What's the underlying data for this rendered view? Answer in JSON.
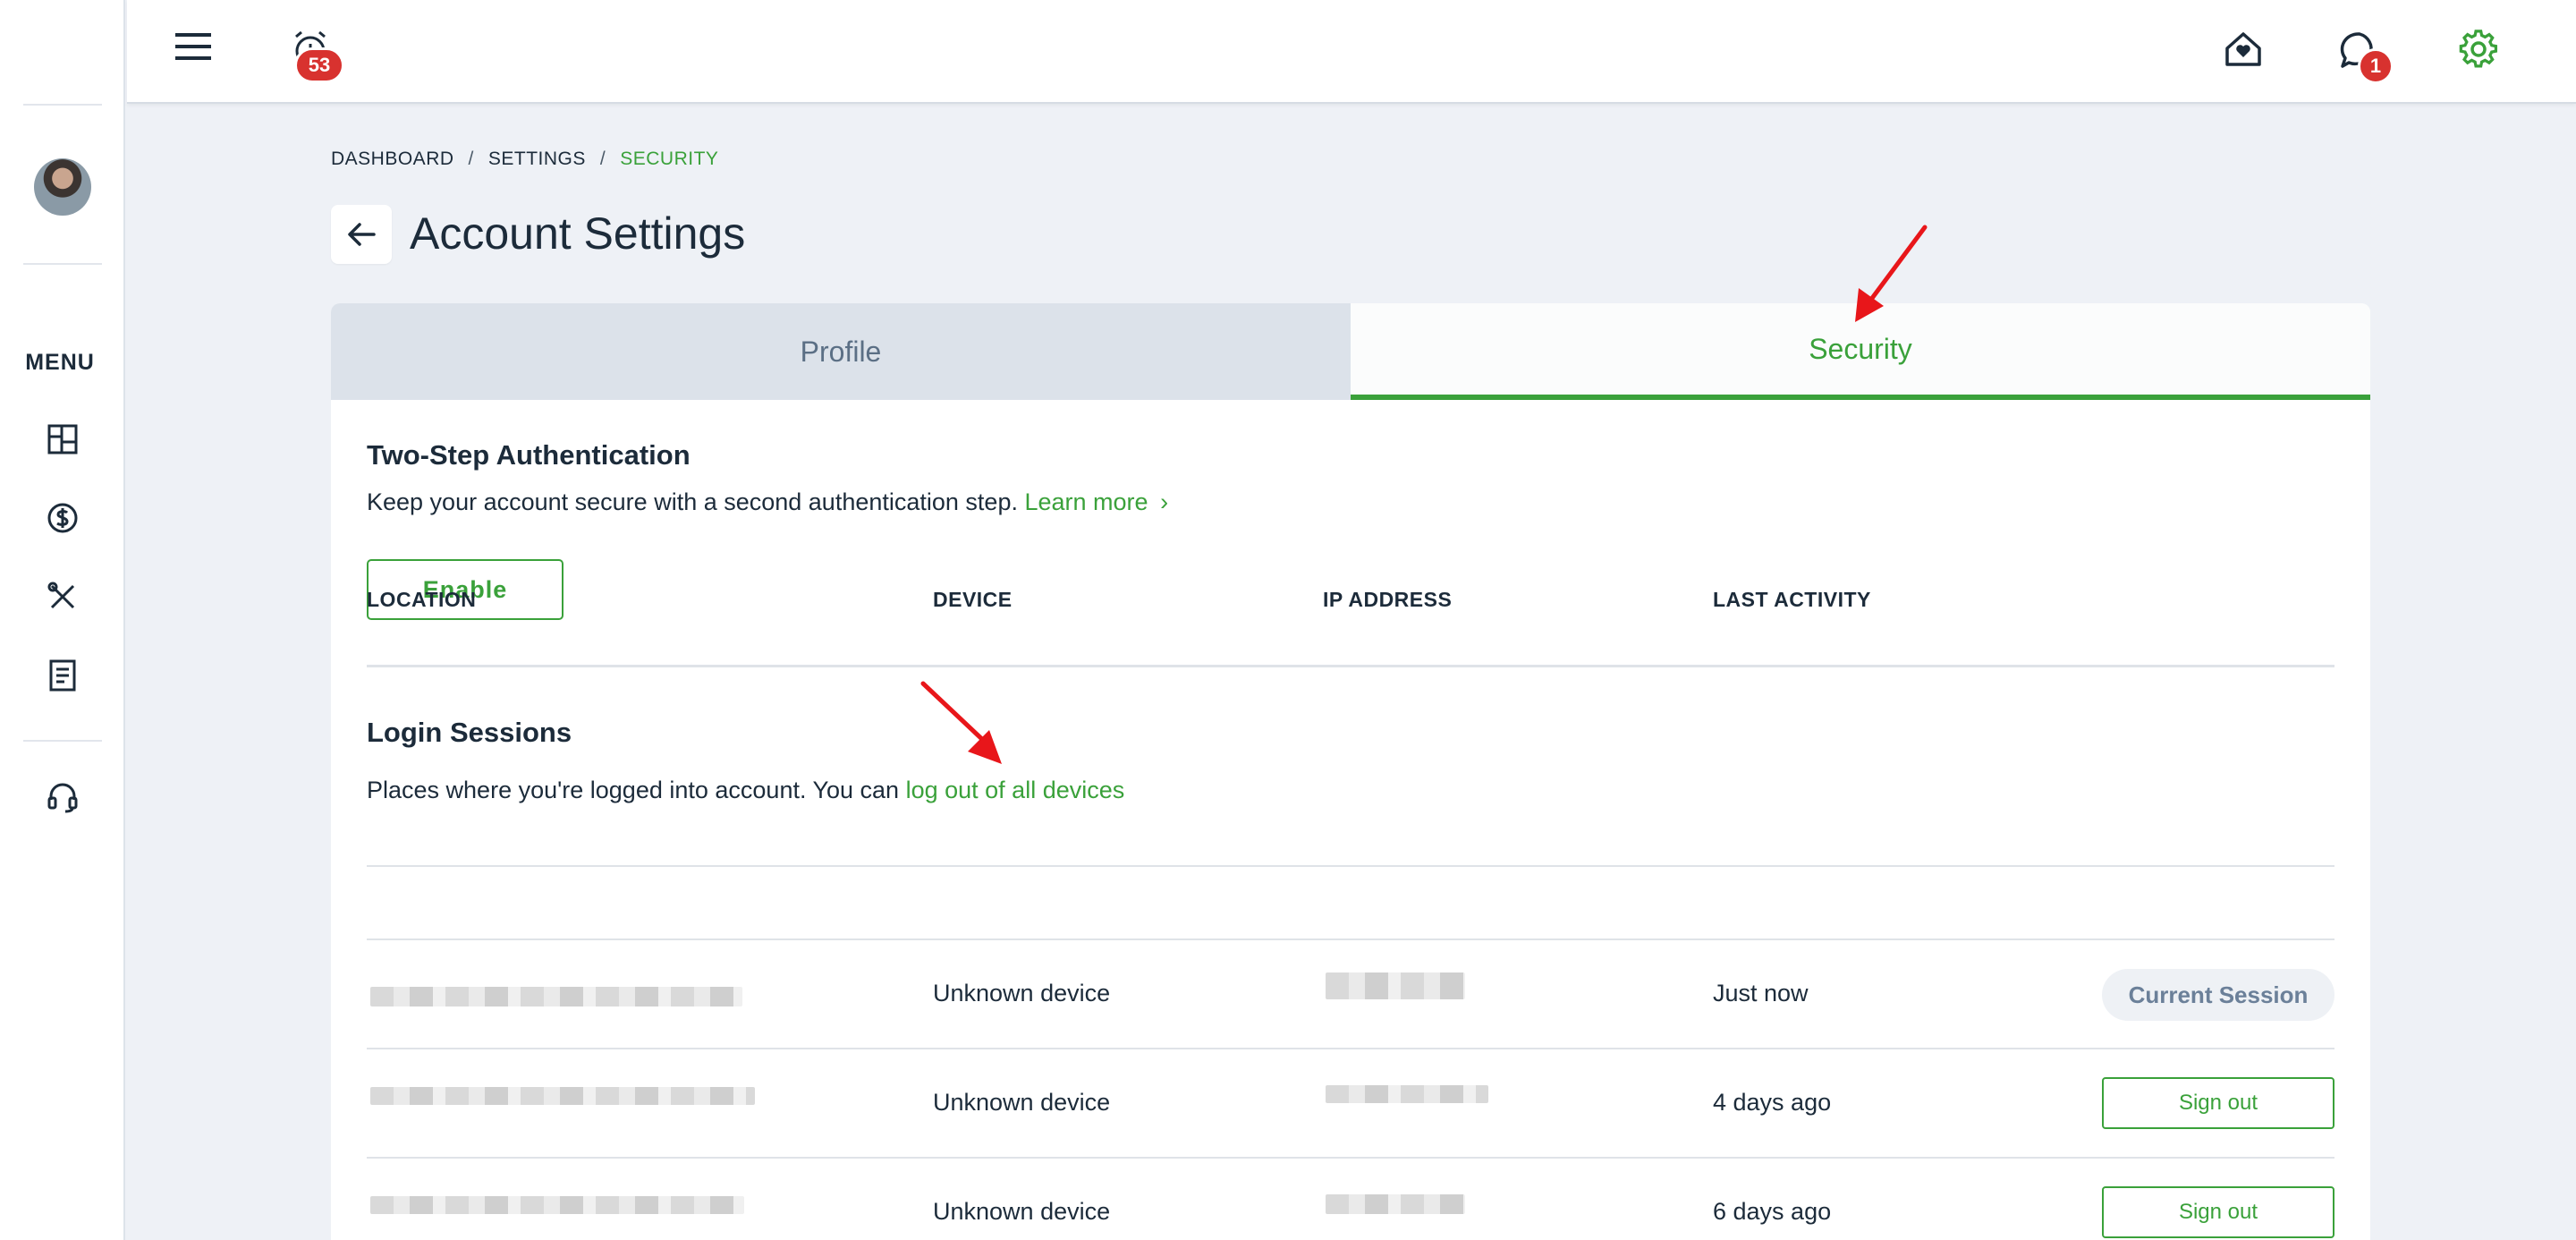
{
  "topbar": {
    "alarm_badge": "53",
    "chat_badge": "1",
    "colors": {
      "badge": "#d8322f",
      "settings_icon": "#3aa13a"
    }
  },
  "sidebar": {
    "menu_label": "MENU",
    "items": [
      {
        "icon": "dashboard-icon"
      },
      {
        "icon": "dollar-icon"
      },
      {
        "icon": "tools-icon"
      },
      {
        "icon": "document-icon"
      },
      {
        "icon": "headset-icon"
      }
    ]
  },
  "breadcrumb": {
    "items": [
      "DASHBOARD",
      "SETTINGS",
      "SECURITY"
    ],
    "separator": "/"
  },
  "page": {
    "title": "Account Settings"
  },
  "tabs": {
    "profile": "Profile",
    "security": "Security",
    "active": "Security"
  },
  "two_step": {
    "title": "Two-Step Authentication",
    "description": "Keep your account secure with a second authentication step.",
    "learn_more": "Learn more",
    "chevron": "›",
    "enable_label": "Enable"
  },
  "sessions": {
    "title": "Login Sessions",
    "description": "Places where you're logged into account. You can",
    "logout_link": "log out of all devices",
    "columns": [
      "LOCATION",
      "DEVICE",
      "IP ADDRESS",
      "LAST ACTIVITY"
    ],
    "rows": [
      {
        "device": "Unknown device",
        "last_activity": "Just now",
        "action": "Current Session"
      },
      {
        "device": "Unknown device",
        "last_activity": "4 days ago",
        "action": "Sign out"
      },
      {
        "device": "Unknown device",
        "last_activity": "6 days ago",
        "action": "Sign out"
      }
    ]
  },
  "colors": {
    "accent": "#3aa13a",
    "annotation_arrow": "#e8161a",
    "page_bg": "#eef1f6"
  }
}
